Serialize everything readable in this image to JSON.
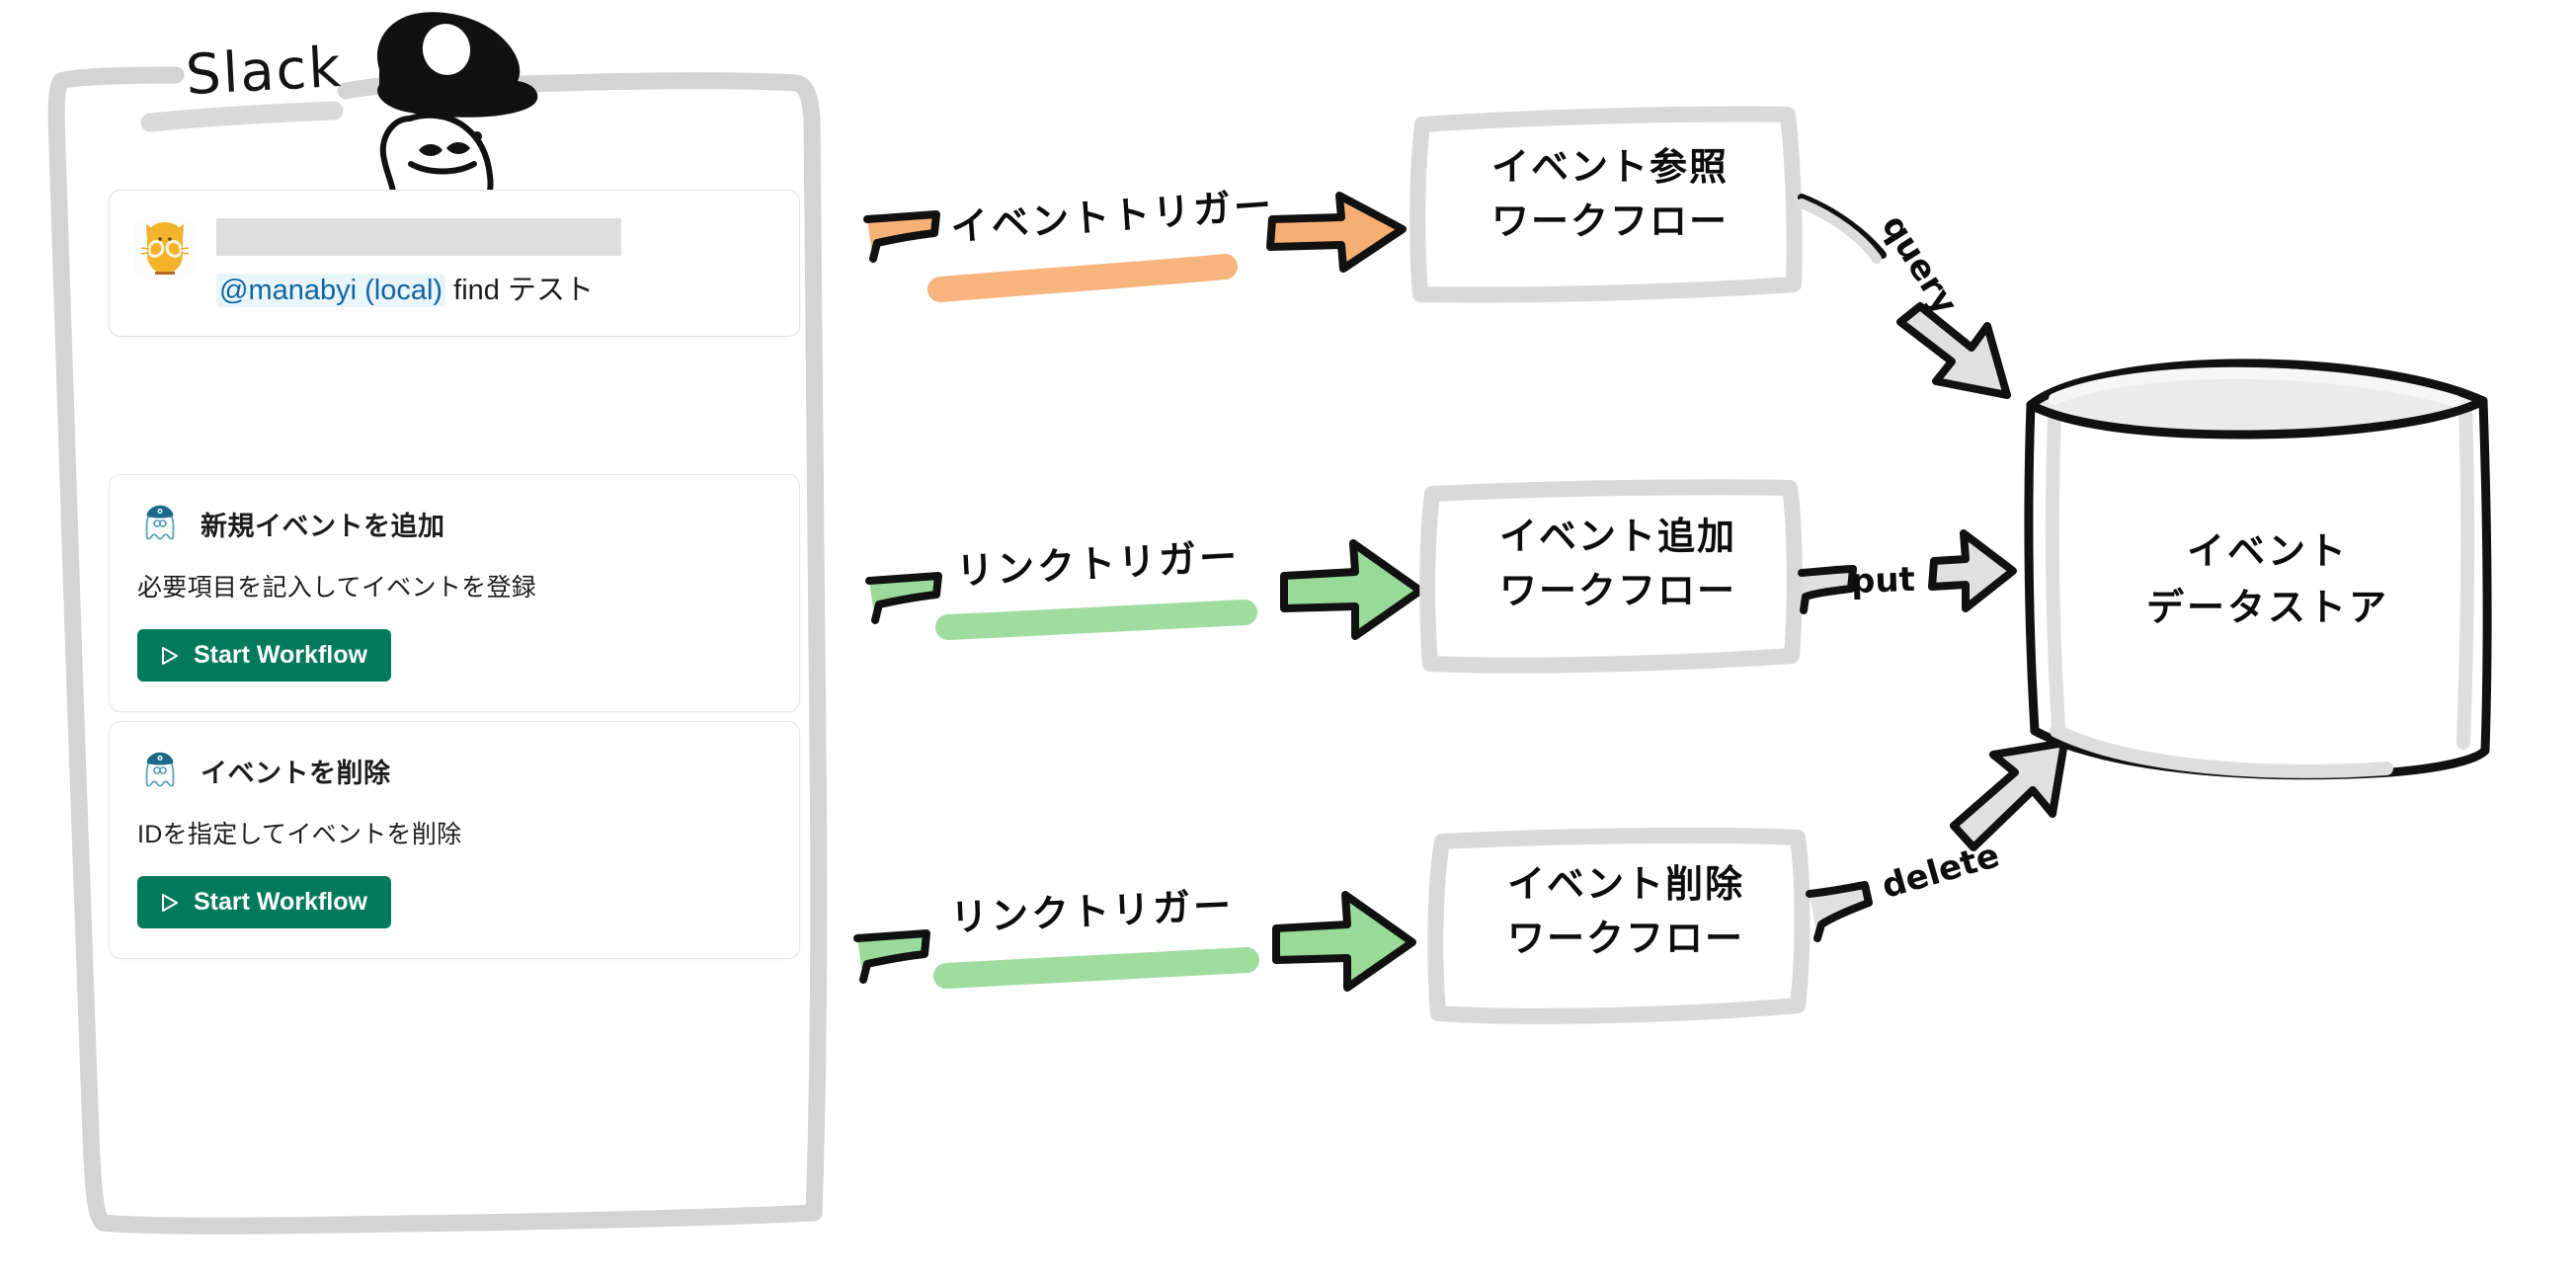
{
  "frame": {
    "app_label": "Slack",
    "mascot_icon": "squid-mascot-icon"
  },
  "slack": {
    "message": {
      "avatar_icon": "cat-avatar-icon",
      "username_redacted": "",
      "mention": "@manabyi (local)",
      "command_text": "find テスト"
    },
    "workflow_cards": [
      {
        "icon": "ghost-sailor-icon",
        "title": "新規イベントを追加",
        "description": "必要項目を記入してイベントを登録",
        "button_label": "Start Workflow",
        "button_icon": "play-triangle-icon"
      },
      {
        "icon": "ghost-sailor-icon",
        "title": "イベントを削除",
        "description": "IDを指定してイベントを削除",
        "button_label": "Start Workflow",
        "button_icon": "play-triangle-icon"
      }
    ]
  },
  "diagram": {
    "triggers": [
      {
        "label": "イベントトリガー",
        "highlight_color": "#f7b177",
        "arrow_color": "#f6ae72"
      },
      {
        "label": "リンクトリガー",
        "highlight_color": "#9ada9a",
        "arrow_color": "#98da98"
      },
      {
        "label": "リンクトリガー",
        "highlight_color": "#9ada9a",
        "arrow_color": "#98da98"
      }
    ],
    "workflow_boxes": [
      {
        "line1": "イベント参照",
        "line2": "ワークフロー"
      },
      {
        "line1": "イベント追加",
        "line2": "ワークフロー"
      },
      {
        "line1": "イベント削除",
        "line2": "ワークフロー"
      }
    ],
    "edge_labels": [
      {
        "text": "query"
      },
      {
        "text": "put"
      },
      {
        "text": "delete"
      }
    ],
    "datastore": {
      "line1": "イベント",
      "line2": "データストア"
    }
  },
  "colors": {
    "slack_green": "#007a5a",
    "mention_blue": "#1264a3",
    "sketch_gray": "#d4d4d4",
    "ink_black": "#0d0d0d",
    "orange_highlight": "#f7b177",
    "green_highlight": "#9ada9a"
  }
}
